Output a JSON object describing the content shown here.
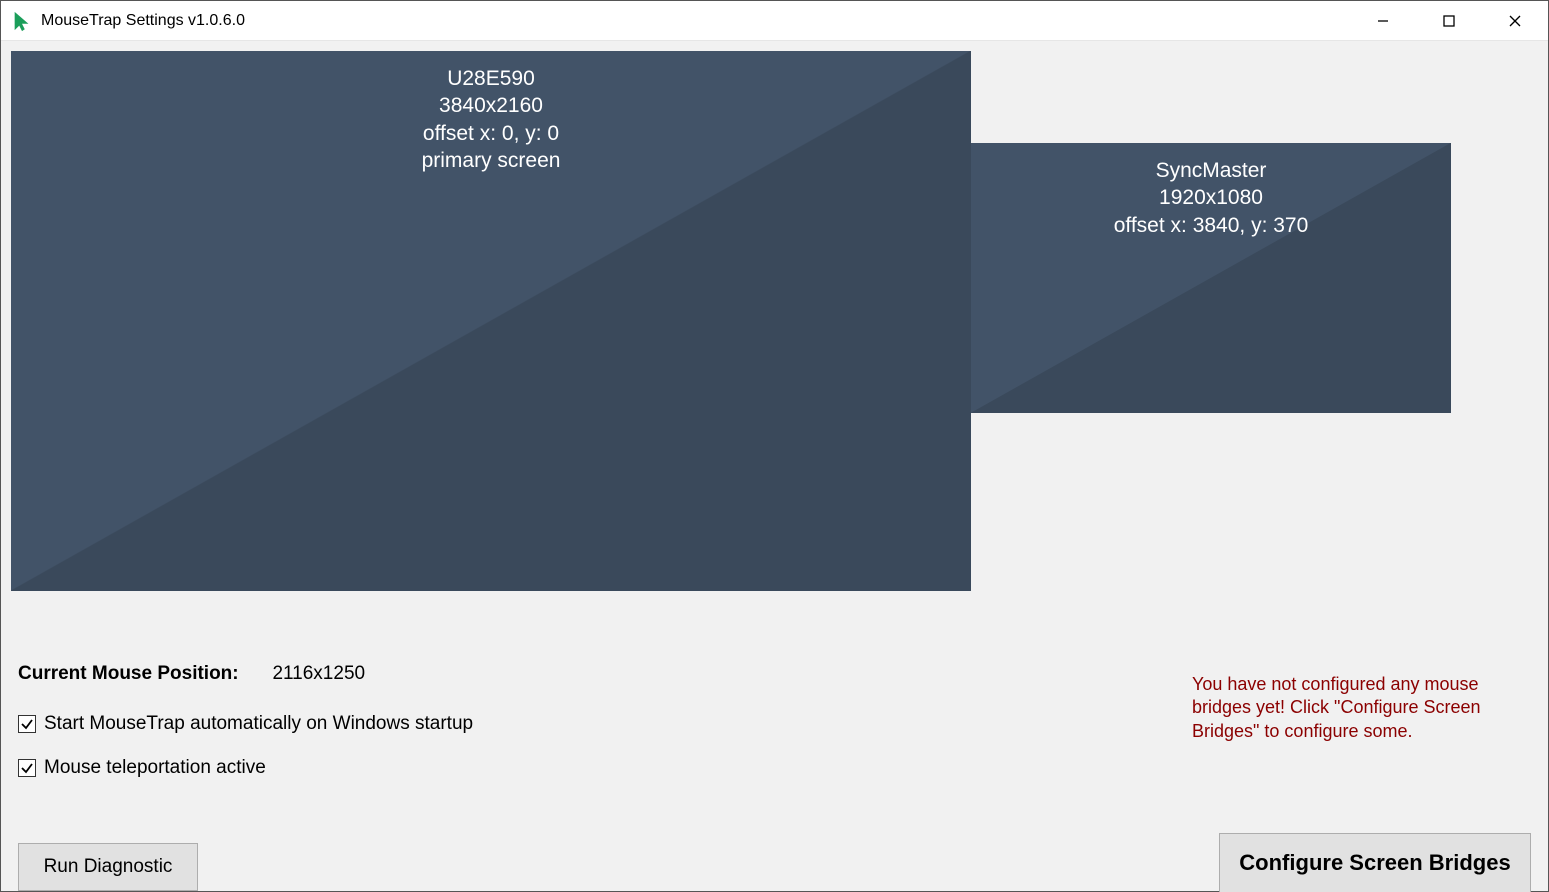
{
  "window": {
    "title": "MouseTrap Settings v1.0.6.0"
  },
  "monitors": {
    "primary": {
      "name": "U28E590",
      "resolution": "3840x2160",
      "offset": "offset x: 0, y: 0",
      "note": "primary screen"
    },
    "secondary": {
      "name": "SyncMaster",
      "resolution": "1920x1080",
      "offset": "offset x: 3840, y: 370"
    }
  },
  "status": {
    "position_label": "Current Mouse Position:",
    "position_value": "2116x1250",
    "checkbox_startup": "Start MouseTrap automatically on Windows startup",
    "checkbox_teleport": "Mouse teleportation active"
  },
  "buttons": {
    "diagnostic": "Run Diagnostic",
    "configure": "Configure Screen Bridges"
  },
  "warning": "You have not configured any mouse bridges yet! Click \"Configure Screen Bridges\" to configure some."
}
